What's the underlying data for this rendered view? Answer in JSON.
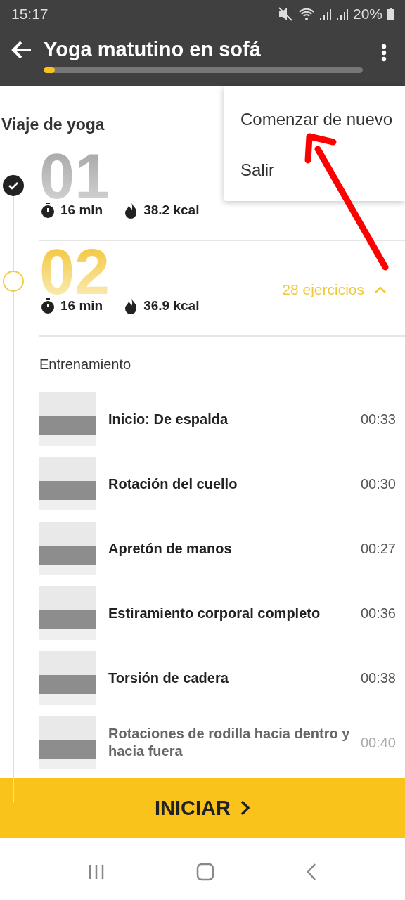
{
  "status_bar": {
    "time": "15:17",
    "battery": "20%"
  },
  "header": {
    "title": "Yoga matutino en sofá",
    "level": 0.03
  },
  "menu": {
    "items": [
      "Comenzar de nuevo",
      "Salir"
    ]
  },
  "section_title": "Viaje de yoga",
  "days": [
    {
      "number": "01",
      "completed": true,
      "current": false,
      "duration": "16 min",
      "kcal": "38.2 kcal"
    },
    {
      "number": "02",
      "completed": false,
      "current": true,
      "expanded": true,
      "exercise_count": "28 ejercicios",
      "duration": "16 min",
      "kcal": "36.9 kcal"
    }
  ],
  "workout": {
    "title": "Entrenamiento",
    "exercises": [
      {
        "name": "Inicio: De espalda",
        "time": "00:33"
      },
      {
        "name": "Rotación del cuello",
        "time": "00:30"
      },
      {
        "name": "Apretón de manos",
        "time": "00:27"
      },
      {
        "name": "Estiramiento corporal completo",
        "time": "00:36"
      },
      {
        "name": "Torsión de cadera",
        "time": "00:38"
      },
      {
        "name": "Rotaciones de rodilla hacia dentro y hacia fuera",
        "time": "00:40"
      }
    ]
  },
  "start_button": {
    "label": "INICIAR"
  }
}
